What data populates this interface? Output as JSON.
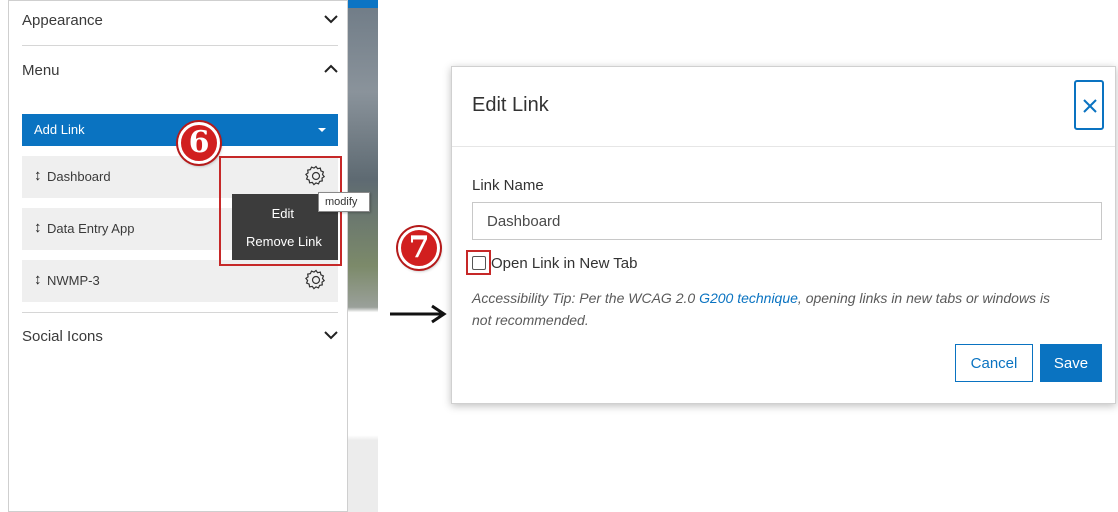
{
  "left_panel": {
    "sections": {
      "appearance": "Appearance",
      "menu": "Menu",
      "social_icons": "Social Icons"
    },
    "add_link_label": "Add Link",
    "links": [
      {
        "label": "Dashboard"
      },
      {
        "label": "Data Entry App"
      },
      {
        "label": "NWMP-3"
      }
    ],
    "context_menu": {
      "edit": "Edit",
      "remove": "Remove Link"
    },
    "tooltip": "modify"
  },
  "callouts": {
    "step6": "6",
    "step7": "7"
  },
  "dialog": {
    "title": "Edit Link",
    "link_name_label": "Link Name",
    "link_name_value": "Dashboard",
    "open_new_tab_label": "Open Link in New Tab",
    "open_new_tab_checked": false,
    "tip_before": "Accessibility Tip: Per the WCAG 2.0 ",
    "tip_link": "G200 technique",
    "tip_after": ", opening links in new tabs or windows is not recommended.",
    "cancel_label": "Cancel",
    "save_label": "Save"
  },
  "colors": {
    "accent": "#0a73c1",
    "callout": "#d11f1f",
    "context_menu_bg": "#3c3c3c"
  },
  "icons": [
    "chevron-down-icon",
    "chevron-up-icon",
    "gear-icon",
    "drag-handle-icon",
    "close-icon",
    "arrow-right-icon",
    "caret-down-icon"
  ]
}
